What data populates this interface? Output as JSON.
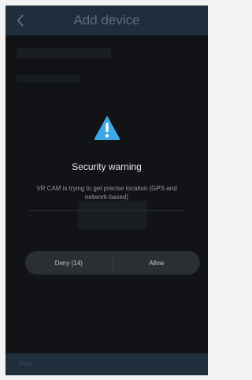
{
  "header": {
    "title": "Add device",
    "back_icon": "chevron-left-icon"
  },
  "dialog": {
    "icon": "warning-triangle-icon",
    "icon_color": "#3ea8e6",
    "title": "Security warning",
    "message": "VR CAM is trying to get precise location (GPS and network-based)",
    "deny_label": "Deny (14)",
    "allow_label": "Allow"
  },
  "bottom_bar": {
    "label": "Post"
  },
  "colors": {
    "header_bg": "#1f2e3c",
    "screen_bg": "#111317",
    "button_bar_bg": "#2b2e33"
  }
}
